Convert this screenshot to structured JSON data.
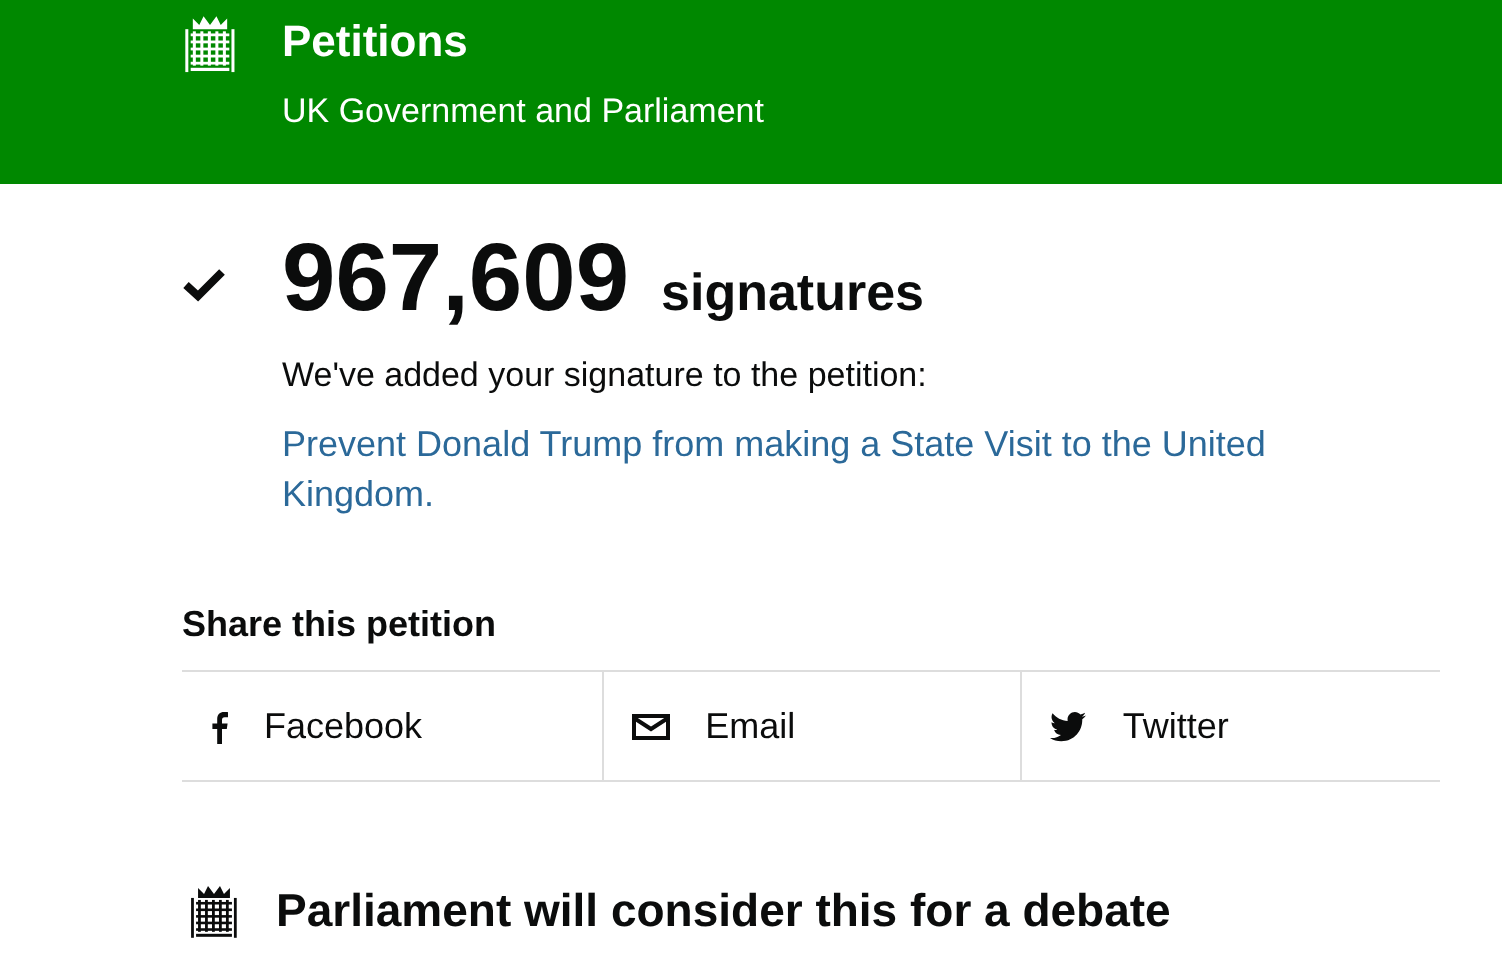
{
  "header": {
    "title": "Petitions",
    "subtitle": "UK Government and Parliament"
  },
  "signatures": {
    "count": "967,609",
    "unit": "signatures",
    "message": "We've added your signature to the petition:",
    "petition_link": "Prevent Donald Trump from making a State Visit to the United Kingdom."
  },
  "share": {
    "heading": "Share this petition",
    "buttons": [
      {
        "kind": "facebook",
        "label": "Facebook"
      },
      {
        "kind": "email",
        "label": "Email"
      },
      {
        "kind": "twitter",
        "label": "Twitter"
      }
    ]
  },
  "debate": {
    "heading": "Parliament will consider this for a debate"
  }
}
